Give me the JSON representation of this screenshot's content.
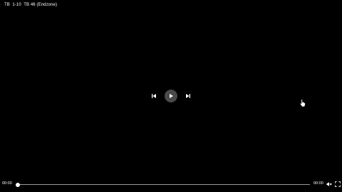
{
  "video": {
    "title": "TB  1-10  TB 46 (Endzone)"
  },
  "controls": {
    "prev_icon": "skip-previous-icon",
    "play_icon": "play-icon",
    "next_icon": "skip-next-icon",
    "volume_icon": "volume-muted-icon",
    "fullscreen_icon": "fullscreen-icon"
  },
  "timeline": {
    "current_time": "00:00",
    "duration": "00:00",
    "progress_fraction": 0
  },
  "colors": {
    "background": "#000000",
    "text": "#ffffff",
    "play_button_bg": "#4a4a4a",
    "track": "#9a9a9a"
  }
}
